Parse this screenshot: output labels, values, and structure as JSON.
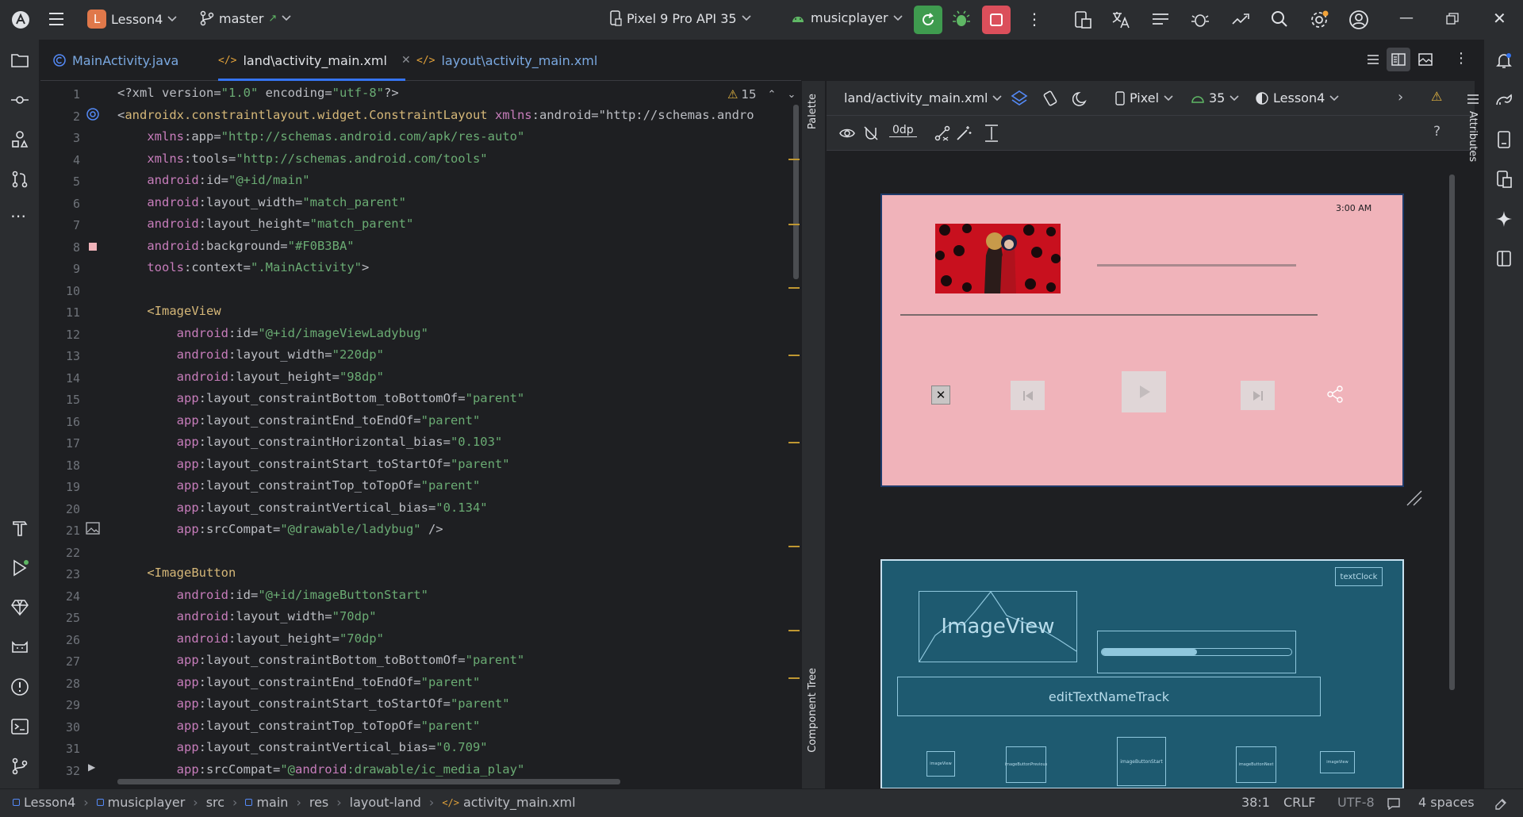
{
  "topbar": {
    "project_initial": "L",
    "project_name": "Lesson4",
    "branch": "master",
    "device": "Pixel 9 Pro API 35",
    "run_config": "musicplayer"
  },
  "tabs": [
    {
      "label": "MainActivity.java",
      "icon": "java-class-icon"
    },
    {
      "label": "land\\activity_main.xml",
      "icon": "xml-icon"
    },
    {
      "label": "layout\\activity_main.xml",
      "icon": "xml-icon"
    }
  ],
  "editor": {
    "warnings_count": "15",
    "line_numbers": [
      "1",
      "2",
      "3",
      "4",
      "5",
      "6",
      "7",
      "8",
      "9",
      "10",
      "11",
      "12",
      "13",
      "14",
      "15",
      "16",
      "17",
      "18",
      "19",
      "20",
      "21",
      "22",
      "23",
      "24",
      "25",
      "26",
      "27",
      "28",
      "29",
      "30",
      "31",
      "32"
    ],
    "lines": [
      "<?xml version=\"1.0\" encoding=\"utf-8\"?>",
      "<androidx.constraintlayout.widget.ConstraintLayout xmlns:android=\"http://schemas.andro",
      "    xmlns:app=\"http://schemas.android.com/apk/res-auto\"",
      "    xmlns:tools=\"http://schemas.android.com/tools\"",
      "    android:id=\"@+id/main\"",
      "    android:layout_width=\"match_parent\"",
      "    android:layout_height=\"match_parent\"",
      "    android:background=\"#F0B3BA\"",
      "    tools:context=\".MainActivity\">",
      "",
      "    <ImageView",
      "        android:id=\"@+id/imageViewLadybug\"",
      "        android:layout_width=\"220dp\"",
      "        android:layout_height=\"98dp\"",
      "        app:layout_constraintBottom_toBottomOf=\"parent\"",
      "        app:layout_constraintEnd_toEndOf=\"parent\"",
      "        app:layout_constraintHorizontal_bias=\"0.103\"",
      "        app:layout_constraintStart_toStartOf=\"parent\"",
      "        app:layout_constraintTop_toTopOf=\"parent\"",
      "        app:layout_constraintVertical_bias=\"0.134\"",
      "        app:srcCompat=\"@drawable/ladybug\" />",
      "",
      "    <ImageButton",
      "        android:id=\"@+id/imageButtonStart\"",
      "        android:layout_width=\"70dp\"",
      "        android:layout_height=\"70dp\"",
      "        app:layout_constraintBottom_toBottomOf=\"parent\"",
      "        app:layout_constraintEnd_toEndOf=\"parent\"",
      "        app:layout_constraintStart_toStartOf=\"parent\"",
      "        app:layout_constraintTop_toTopOf=\"parent\"",
      "        app:layout_constraintVertical_bias=\"0.709\"",
      "        app:srcCompat=\"@android:drawable/ic_media_play\""
    ]
  },
  "design": {
    "palette_label": "Palette",
    "component_tree_label": "Component Tree",
    "attributes_label": "Attributes",
    "file": "land/activity_main.xml",
    "device": "Pixel",
    "api": "35",
    "theme": "Lesson4",
    "margin": "0dp",
    "preview_clock": "3:00 AM",
    "blueprint": {
      "textclock": "textClock",
      "imageview": "ImageView",
      "edittext": "editTextNameTrack",
      "btn_image": "imageView",
      "btn_prev": "imageButtonPrevious",
      "btn_start": "imageButtonStart",
      "btn_next": "imageButtonNext",
      "btn_share": "imageView"
    }
  },
  "status": {
    "crumbs": [
      "Lesson4",
      "musicplayer",
      "src",
      "main",
      "res",
      "layout-land",
      "activity_main.xml"
    ],
    "position": "38:1",
    "line_ending": "CRLF",
    "encoding": "UTF-8",
    "indent": "4 spaces"
  },
  "colors": {
    "accent": "#3574f0",
    "run_green": "#3f9b4f",
    "stop_red": "#db4f5b",
    "preview_bg": "#F0B3BA",
    "blueprint_bg": "#1e5a70"
  }
}
